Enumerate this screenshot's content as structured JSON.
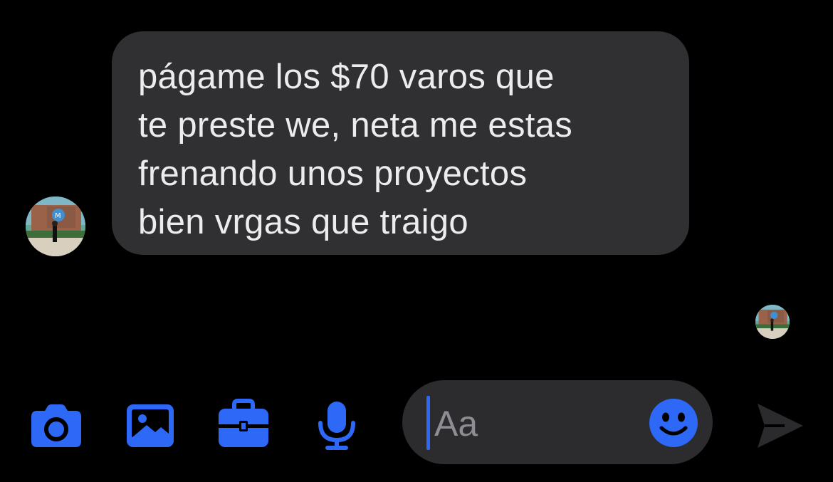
{
  "conversation": {
    "incoming_message": {
      "text": "págame los $70 varos que\nte preste we, neta me estas\nfrenando unos proyectos\nbien vrgas que traigo"
    },
    "sender_avatar": {
      "icon": "profile-photo"
    },
    "read_receipt_avatar": {
      "icon": "profile-photo"
    }
  },
  "composer": {
    "placeholder": "Aa",
    "buttons": {
      "camera": {
        "icon": "camera-icon"
      },
      "gallery": {
        "icon": "image-icon"
      },
      "apps": {
        "icon": "suitcase-icon"
      },
      "voice": {
        "icon": "microphone-icon"
      },
      "emoji": {
        "icon": "smiley-icon"
      },
      "send": {
        "icon": "send-icon"
      }
    }
  },
  "colors": {
    "background": "#000000",
    "bubble": "#303032",
    "accent": "#2d68f7",
    "send_disabled": "#2b2b2d"
  }
}
